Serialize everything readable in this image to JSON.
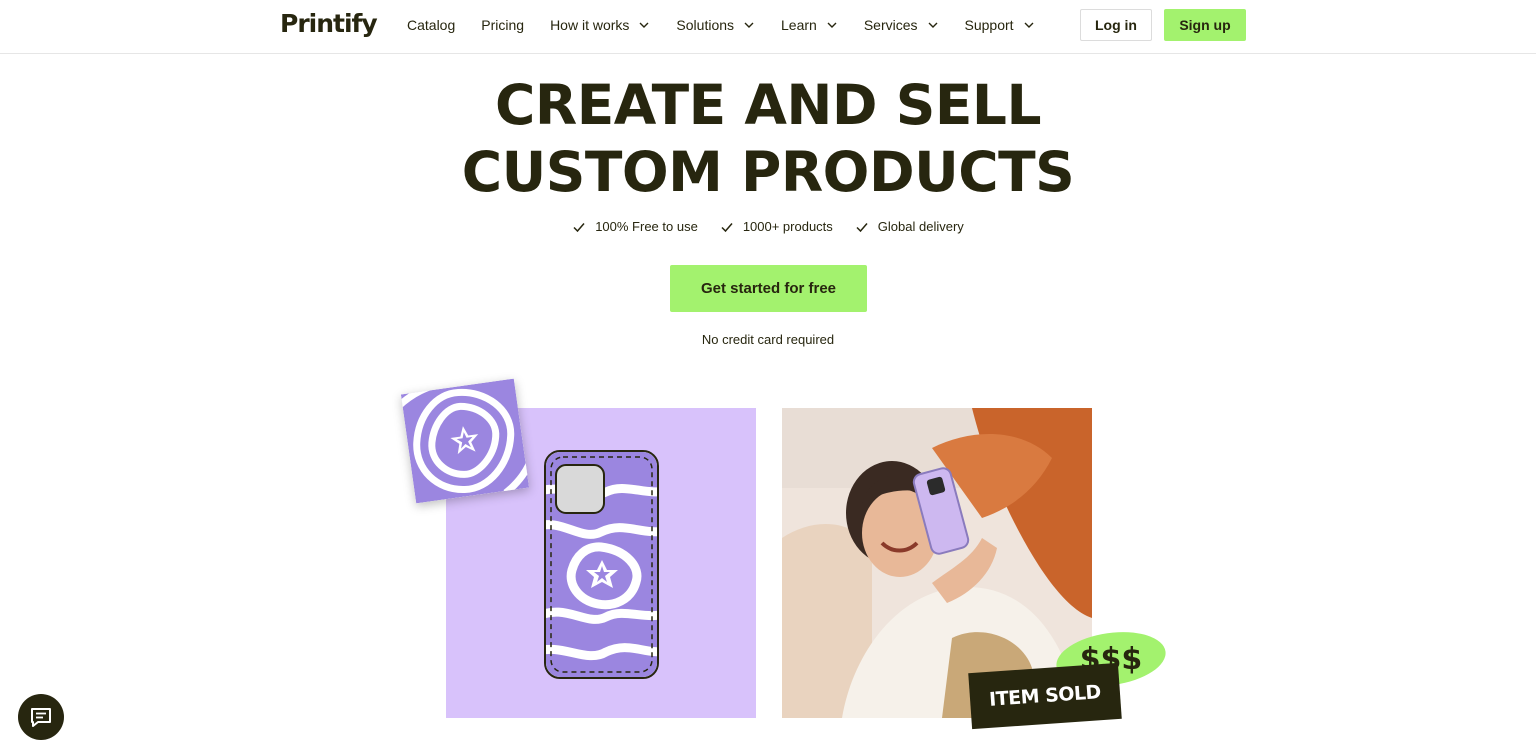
{
  "header": {
    "logo": "Printify",
    "nav": [
      {
        "label": "Catalog",
        "dropdown": false
      },
      {
        "label": "Pricing",
        "dropdown": false
      },
      {
        "label": "How it works",
        "dropdown": true
      },
      {
        "label": "Solutions",
        "dropdown": true
      },
      {
        "label": "Learn",
        "dropdown": true
      },
      {
        "label": "Services",
        "dropdown": true
      },
      {
        "label": "Support",
        "dropdown": true
      }
    ],
    "login_label": "Log in",
    "signup_label": "Sign up"
  },
  "hero": {
    "title_line1": "CREATE AND SELL",
    "title_line2": "CUSTOM PRODUCTS",
    "features": [
      "100% Free to use",
      "1000+ products",
      "Global delivery"
    ],
    "cta_label": "Get started for free",
    "note": "No credit card required"
  },
  "visuals": {
    "money_badge": "$$$",
    "sold_badge": "ITEM SOLD"
  },
  "icons": {
    "chat": "chat-bubble-icon",
    "check": "check-icon",
    "chevron": "chevron-down-icon"
  },
  "colors": {
    "brand_dark": "#27260f",
    "accent_green": "#a3f26e",
    "lavender": "#d8c2fb",
    "swirl_purple": "#9b86e0"
  }
}
